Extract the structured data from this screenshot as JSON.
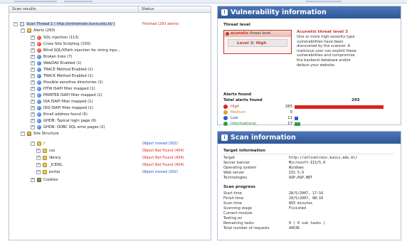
{
  "left_pane": {
    "col_name": "Scan results",
    "col_status": "Status",
    "rows": [
      {
        "label": "Scan Thread 1 ( http://onlinetrain.kuniv.edu.kl/ )",
        "icon": "target-icon",
        "status": "Finished (293 alerts)",
        "status_color": "red"
      },
      {
        "label": "Alerts (293)",
        "icon": "alerts-folder-icon"
      },
      {
        "label": "SQL injection (113)",
        "icon": "high-alert-icon"
      },
      {
        "label": "Cross Site Scripting (150)",
        "icon": "high-alert-icon"
      },
      {
        "label": "Blind SQL/XPath injection for string inpu...",
        "icon": "high-alert-icon"
      },
      {
        "label": "Broken links (7)",
        "icon": "info-alert-icon"
      },
      {
        "label": "WebDAV Enabled (1)",
        "icon": "info-alert-icon"
      },
      {
        "label": "TRACE Method Enabled (1)",
        "icon": "info-alert-icon"
      },
      {
        "label": "TRACK Method Enabled (1)",
        "icon": "info-alert-icon"
      },
      {
        "label": "Possible sensitive directories (1)",
        "icon": "info-alert-icon"
      },
      {
        "label": "HTW ISAPI filter mapped (1)",
        "icon": "info-alert-icon"
      },
      {
        "label": "PRINTER ISAPI filter mapped (1)",
        "icon": "info-alert-icon"
      },
      {
        "label": "IDA ISAPI filter mapped (1)",
        "icon": "info-alert-icon"
      },
      {
        "label": "IDQ ISAPI filter mapped (1)",
        "icon": "info-alert-icon"
      },
      {
        "label": "Email address found (5)",
        "icon": "info-alert-icon"
      },
      {
        "label": "GHDB: Typical login page (6)",
        "icon": "info-alert-icon"
      },
      {
        "label": "GHDB: ODBC SQL error pages (2)",
        "icon": "info-alert-icon"
      },
      {
        "label": "Site Structure",
        "icon": "site-structure-icon"
      },
      {
        "label": "/",
        "icon": "folder-icon",
        "status": "Object moved (302)",
        "status_color": "blue"
      },
      {
        "label": "css",
        "icon": "folder-icon",
        "status": "Object Not Found (404)",
        "status_color": "red"
      },
      {
        "label": "library",
        "icon": "folder-icon",
        "status": "Object Not Found (404)",
        "status_color": "red"
      },
      {
        "label": "_ICEIKL",
        "icon": "folder-icon",
        "status": "Object Not Found (404)",
        "status_color": "red"
      },
      {
        "label": "portal",
        "icon": "folder-icon",
        "status": "Object moved (302)",
        "status_color": "blue"
      },
      {
        "label": "Cookies",
        "icon": "cookies-icon"
      }
    ]
  },
  "vuln_panel": {
    "title": "Vulnerability information",
    "threat_level_heading": "Threat level",
    "brand": "acunetix",
    "brand_suffix": "threat level",
    "level_text": "Level 3: High",
    "acu_title": "Acunetix threat level 3",
    "acu_desc": "One or more high-severity type vulnerabilities have been discovered by the scanner. A malicious user can exploit these vulnerabilities and compromise the backend database and/or deface your website.",
    "alerts_found_heading": "Alerts found",
    "total_label": "Total alerts found",
    "total_value": "293",
    "severities": [
      {
        "name": "High",
        "count": "265",
        "value": 265,
        "color": "#d9231c",
        "name_color": "#c0392b"
      },
      {
        "name": "Medium",
        "count": "0",
        "value": 0,
        "color": "#e8a11c",
        "name_color": "#d48a10"
      },
      {
        "name": "Low",
        "count": "11",
        "value": 11,
        "color": "#2a5fcf",
        "name_color": "#1d4fc9"
      },
      {
        "name": "Informational",
        "count": "17",
        "value": 17,
        "color": "#2f9e3a",
        "name_color": "#2a8a35"
      }
    ]
  },
  "scan_panel": {
    "title": "Scan information",
    "target_heading": "Target information",
    "target_rows": [
      {
        "k": "Target",
        "v": "http://onlinetrain.kuniv.edu.kl/"
      },
      {
        "k": "Server banner",
        "v": "Microsoft-IIS/5.0"
      },
      {
        "k": "Operating system",
        "v": "Windows"
      },
      {
        "k": "Web server",
        "v": "IIS 5.0"
      },
      {
        "k": "Technologies",
        "v": "ASP,ASP.NET"
      }
    ],
    "progress_heading": "Scan progress",
    "progress_rows": [
      {
        "k": "Start time",
        "v": "28/5/2007, 17:16"
      },
      {
        "k": "Finish time",
        "v": "29/5/2007, 08:10"
      },
      {
        "k": "Scan time",
        "v": "893 minutes"
      },
      {
        "k": "Scanning stage",
        "v": "Finished"
      },
      {
        "k": "Current module",
        "v": ""
      },
      {
        "k": "Testing on",
        "v": ""
      },
      {
        "k": "Remaining tasks",
        "v": "0 ( 0 sub tasks )"
      },
      {
        "k": "Total number of requests",
        "v": "44536"
      }
    ]
  }
}
